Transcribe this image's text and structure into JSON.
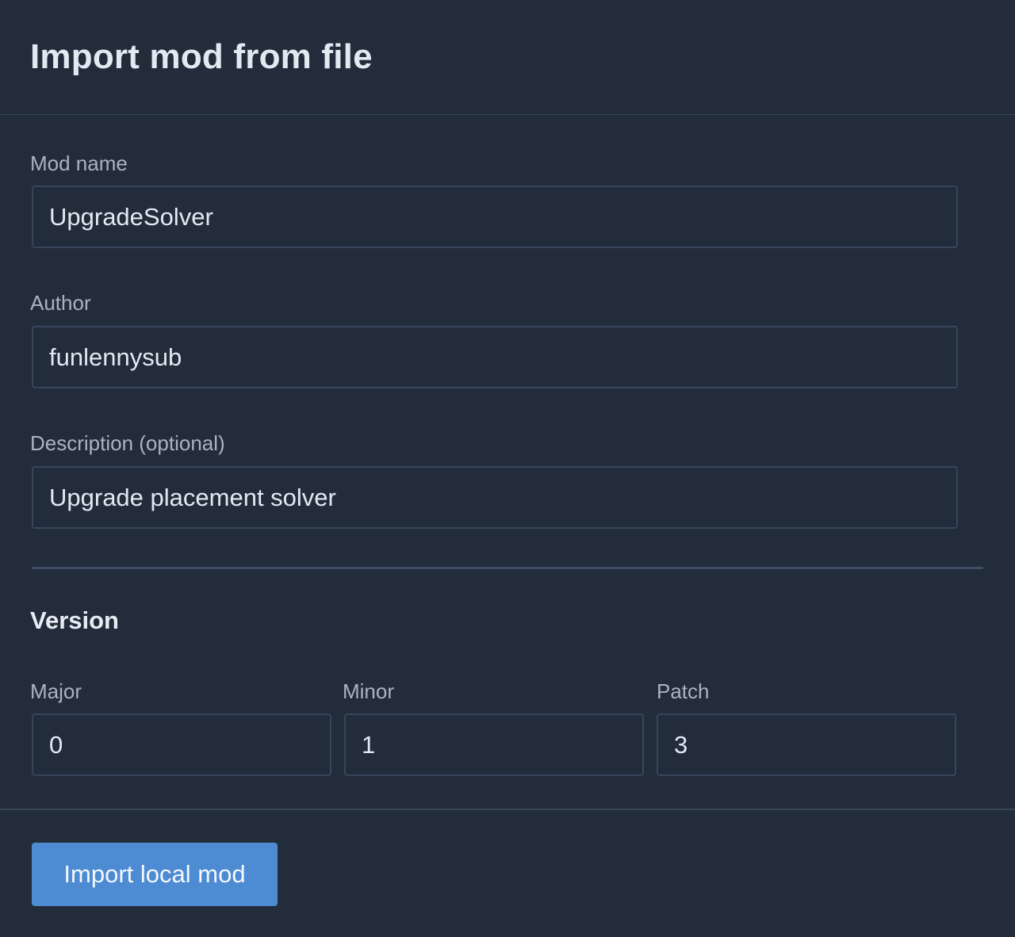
{
  "dialog": {
    "title": "Import mod from file"
  },
  "form": {
    "mod_name": {
      "label": "Mod name",
      "value": "UpgradeSolver"
    },
    "author": {
      "label": "Author",
      "value": "funlennysub"
    },
    "description": {
      "label": "Description (optional)",
      "value": "Upgrade placement solver"
    }
  },
  "version": {
    "title": "Version",
    "major": {
      "label": "Major",
      "value": "0"
    },
    "minor": {
      "label": "Minor",
      "value": "1"
    },
    "patch": {
      "label": "Patch",
      "value": "3"
    }
  },
  "footer": {
    "import_label": "Import local mod"
  },
  "colors": {
    "background": "#222c3b",
    "accent": "#4d8bd2",
    "border": "#38455a"
  }
}
